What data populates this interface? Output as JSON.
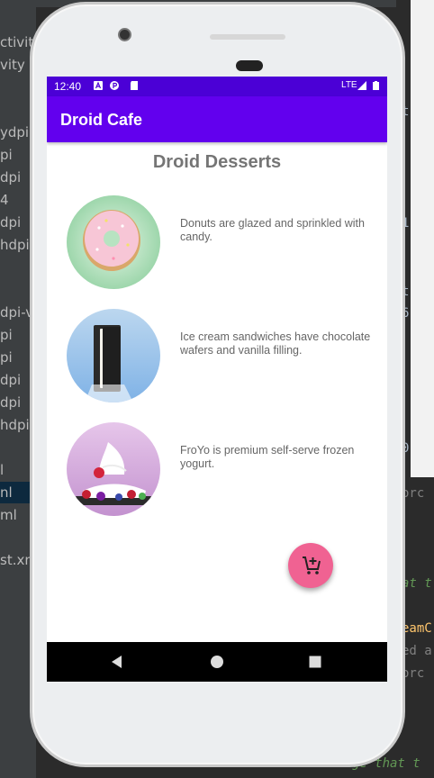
{
  "ide": {
    "left_labels": [
      "ctivity",
      "vity",
      "ydpi",
      "pi",
      "dpi",
      "4",
      "dpi",
      "hdpi",
      "dpi-v",
      "pi",
      "pi",
      "dpi",
      "dpi",
      "hdpi",
      "l",
      "nl",
      "ml",
      "st.xm"
    ],
    "right_code": [
      "t",
      "t",
      "1",
      "6",
      "0",
      "orc",
      "at t",
      "eamC",
      "ed a",
      "orc",
      "sage that t"
    ]
  },
  "status_bar": {
    "time": "12:40",
    "network": "LTE"
  },
  "app_bar": {
    "title": "Droid Cafe"
  },
  "main": {
    "heading": "Droid Desserts",
    "items": [
      {
        "image": "donut-image",
        "description": "Donuts are glazed and sprinkled with candy."
      },
      {
        "image": "ice-cream-sandwich-image",
        "description": "Ice cream sandwiches have chocolate wafers and vanilla filling."
      },
      {
        "image": "froyo-image",
        "description": "FroYo is premium self-serve frozen yogurt."
      }
    ]
  },
  "fab": {
    "icon": "add-shopping-cart-icon",
    "color": "#f06292"
  },
  "nav": {
    "back": "back-icon",
    "home": "home-icon",
    "recents": "recents-icon"
  },
  "colors": {
    "primary": "#6200ee",
    "primary_dark": "#4b00d6",
    "accent": "#f06292"
  }
}
